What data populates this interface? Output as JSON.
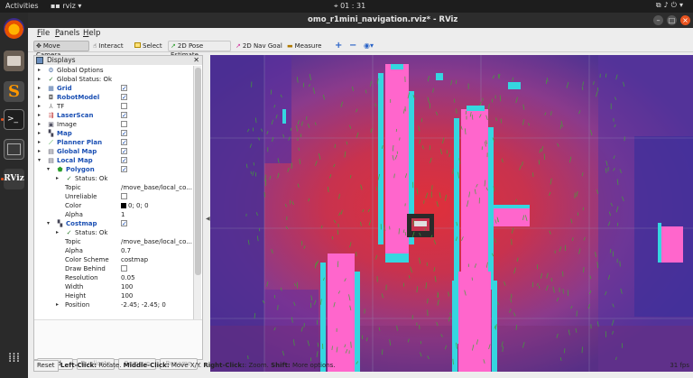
{
  "topbar": {
    "activities": "Activities",
    "app": "rviz",
    "clock": "01 : 31"
  },
  "window": {
    "title": "omo_r1mini_navigation.rviz* - RViz"
  },
  "menu": [
    {
      "label": "File",
      "key": "F",
      "rest": "ile"
    },
    {
      "label": "Panels",
      "key": "P",
      "rest": "anels"
    },
    {
      "label": "Help",
      "key": "H",
      "rest": "elp"
    }
  ],
  "toolbar": {
    "move_camera": "Move Camera",
    "interact": "Interact",
    "select": "Select",
    "pose_estimate": "2D Pose Estimate",
    "nav_goal": "2D Nav Goal",
    "measure": "Measure"
  },
  "displays": {
    "title": "Displays",
    "rows": [
      {
        "label": "Global Options",
        "icon": "gear-icon"
      },
      {
        "label": "Global Status: Ok",
        "icon": "check-icon"
      },
      {
        "label": "Grid",
        "icon": "grid-icon",
        "checked": true
      },
      {
        "label": "RobotModel",
        "icon": "robot-icon",
        "checked": true
      },
      {
        "label": "TF",
        "icon": "tf-icon",
        "checked": false
      },
      {
        "label": "LaserScan",
        "icon": "laser-icon",
        "checked": true
      },
      {
        "label": "Image",
        "icon": "image-icon",
        "checked": false
      },
      {
        "label": "Map",
        "icon": "map-icon",
        "checked": true
      },
      {
        "label": "Planner Plan",
        "icon": "path-icon",
        "checked": true
      },
      {
        "label": "Global Map",
        "icon": "folder-icon",
        "checked": true
      },
      {
        "label": "Local Map",
        "icon": "folder-icon",
        "checked": true
      },
      {
        "label": "Polygon",
        "icon": "polygon-icon",
        "checked": true
      },
      {
        "label": "Status: Ok",
        "icon": "check-icon"
      },
      {
        "label": "Topic",
        "value": "/move_base/local_co..."
      },
      {
        "label": "Unreliable",
        "checked": false
      },
      {
        "label": "Color",
        "value": "0; 0; 0"
      },
      {
        "label": "Alpha",
        "value": "1"
      },
      {
        "label": "Costmap",
        "icon": "map-icon",
        "checked": true
      },
      {
        "label": "Status: Ok",
        "icon": "check-icon"
      },
      {
        "label": "Topic",
        "value": "/move_base/local_co..."
      },
      {
        "label": "Alpha",
        "value": "0.7"
      },
      {
        "label": "Color Scheme",
        "value": "costmap"
      },
      {
        "label": "Draw Behind",
        "checked": false
      },
      {
        "label": "Resolution",
        "value": "0.05"
      },
      {
        "label": "Width",
        "value": "100"
      },
      {
        "label": "Height",
        "value": "100"
      },
      {
        "label": "Position",
        "value": "-2.45; -2.45; 0"
      }
    ],
    "buttons": {
      "add": "Add",
      "duplicate": "Duplicate",
      "remove": "Remove",
      "rename": "Rename"
    }
  },
  "status": {
    "reset": "Reset",
    "left_click": "Left-Click:",
    "left_action": " Rotate. ",
    "middle_click": "Middle-Click:",
    "middle_action": " Move X/Y. ",
    "right_click": "Right-Click:",
    "right_action": ": Zoom. ",
    "shift": "Shift:",
    "shift_action": " More options.",
    "fps": "31 fps"
  }
}
